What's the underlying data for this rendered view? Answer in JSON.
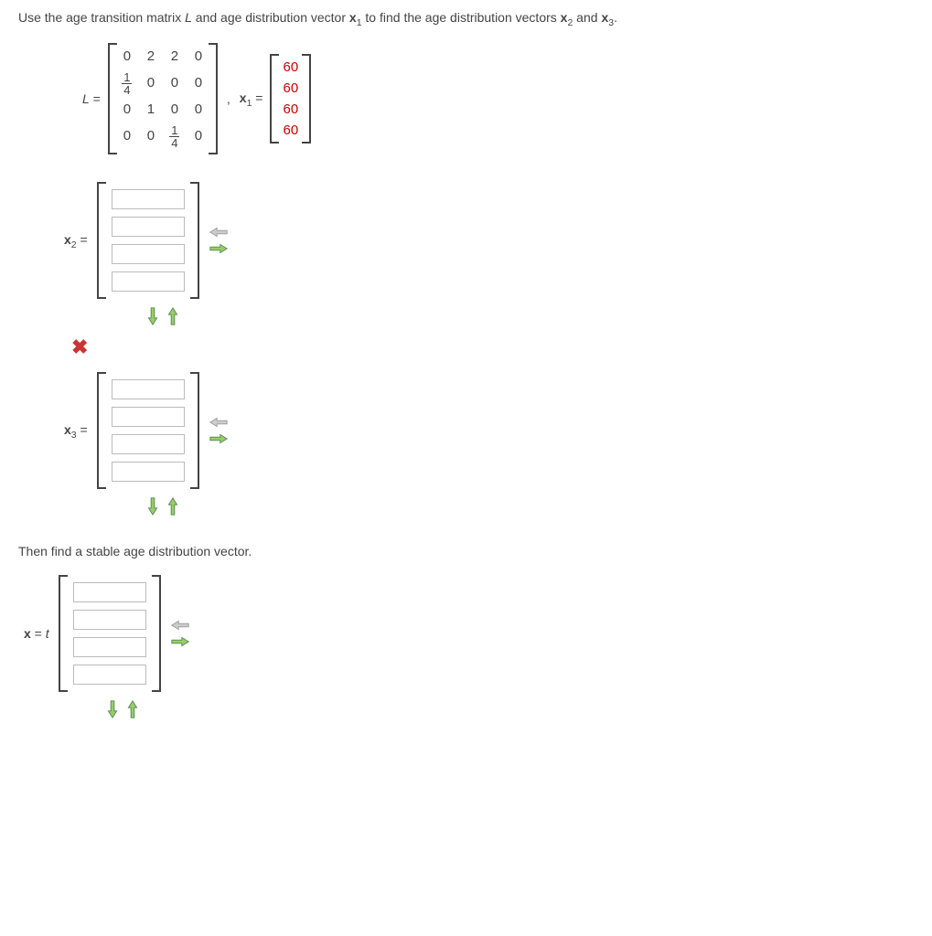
{
  "instruction_parts": {
    "p1": "Use the age transition matrix ",
    "L": "L",
    "p2": " and age distribution vector ",
    "x1b": "x",
    "x1s": "1",
    "p3": " to find the age distribution vectors ",
    "x2b": "x",
    "x2s": "2",
    "p4": " and ",
    "x3b": "x",
    "x3s": "3",
    "p5": "."
  },
  "given": {
    "L_label_var": "L",
    "L_label_eq": " = ",
    "L_rows": [
      [
        "0",
        "2",
        "2",
        "0"
      ],
      [
        "frac:1/4",
        "0",
        "0",
        "0"
      ],
      [
        "0",
        "1",
        "0",
        "0"
      ],
      [
        "0",
        "0",
        "frac:1/4",
        "0"
      ]
    ],
    "between": ",   ",
    "x1_label_b": "x",
    "x1_label_s": "1",
    "x1_label_eq": " = ",
    "x1_values": [
      "60",
      "60",
      "60",
      "60"
    ]
  },
  "answers": {
    "x2": {
      "label_b": "x",
      "label_s": "2",
      "label_eq": " = ",
      "rows": 4
    },
    "x3": {
      "label_b": "x",
      "label_s": "3",
      "label_eq": " = ",
      "rows": 4
    },
    "stable_line": "Then find a stable age distribution vector.",
    "xt": {
      "label_b": "x",
      "label_mid": " = ",
      "t": "t",
      "rows": 4
    }
  },
  "icons": {
    "wrong": "✖"
  }
}
